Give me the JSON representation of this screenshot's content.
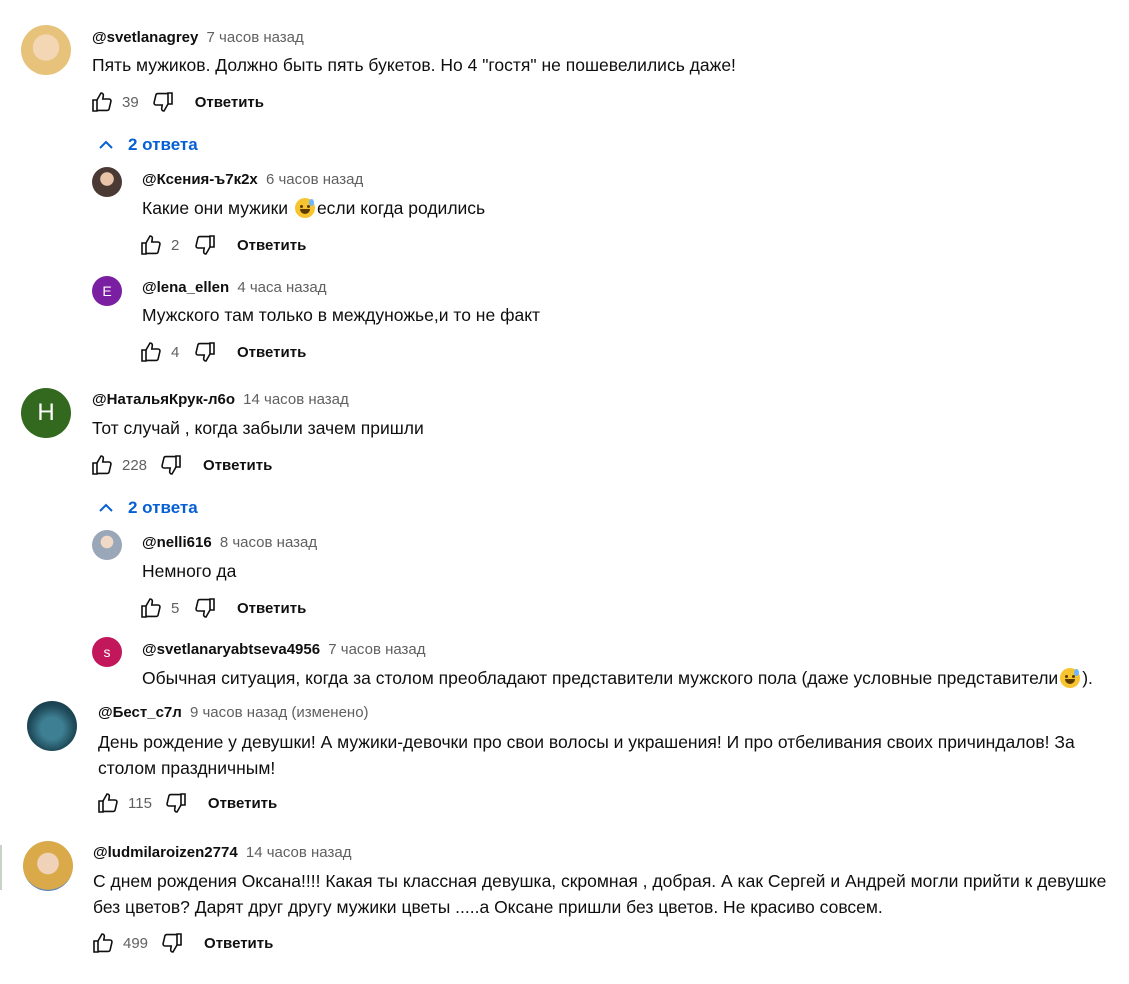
{
  "labels": {
    "reply": "Ответить"
  },
  "comments": [
    {
      "author": "@svetlanagrey",
      "time": "7 часов назад",
      "text": "Пять мужиков. Должно быть пять букетов. Но 4 \"гостя\" не пошевелились даже!",
      "likes": "39",
      "avatar_color": "#e7c27a",
      "replies_toggle": "2 ответа",
      "replies": [
        {
          "author": "@Ксения-ъ7к2х",
          "time": "6 часов назад",
          "text_before": "Какие они мужики ",
          "emoji": "smiling-sweat-emoji",
          "text_after": "если когда родились",
          "likes": "2",
          "avatar_color": "#6b5548"
        },
        {
          "author": "@lena_ellen",
          "time": "4 часа назад",
          "text": "Мужского там только в междуножье,и то не факт",
          "likes": "4",
          "avatar_letter": "E",
          "avatar_color": "#7b1fa2"
        }
      ]
    },
    {
      "author": "@НатальяКрук-л6о",
      "time": "14 часов назад",
      "text": "Тот случай , когда забыли зачем пришли",
      "likes": "228",
      "avatar_letter": "Н",
      "avatar_color": "#33691e",
      "replies_toggle": "2 ответа",
      "replies": [
        {
          "author": "@nelli616",
          "time": "8 часов назад",
          "text": "Немного да",
          "likes": "5",
          "avatar_color": "#9aa7b8"
        },
        {
          "author": "@svetlanaryabtseva4956",
          "time": "7 часов назад",
          "text_before": "Обычная ситуация, когда за столом преобладают представители мужского пола (даже условные представители",
          "emoji": "smiling-sweat-emoji",
          "text_after": ").",
          "avatar_letter": "s",
          "avatar_color": "#c2185b"
        }
      ]
    },
    {
      "author": "@Бест_с7л",
      "time": "9 часов назад (изменено)",
      "text": "День рождение у девушки! А мужики-девочки про свои волосы и украшения! И про отбеливания своих причиндалов! За столом праздничным!",
      "likes": "115",
      "avatar_color": "#1f4b5a"
    },
    {
      "author": "@ludmilaroizen2774",
      "time": "14 часов назад",
      "text": "С днем рождения Оксана!!!! Какая ты классная девушка, скромная , добрая.  А как Сергей и Андрей могли прийти к девушке без цветов?  Дарят друг другу мужики цветы .....а Оксане пришли без цветов. Не красиво совсем.",
      "likes": "499",
      "avatar_color": "#d9a94a"
    }
  ]
}
